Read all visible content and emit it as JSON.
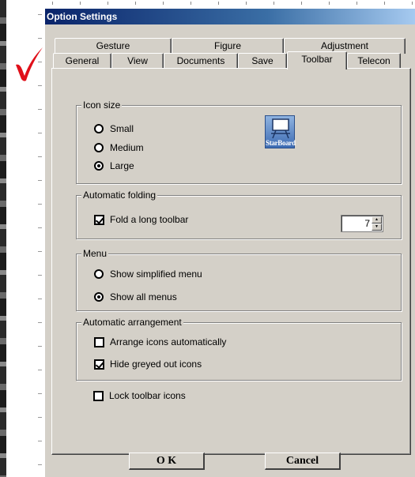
{
  "window": {
    "title": "Option Settings"
  },
  "tabs": {
    "back_row": [
      "Gesture",
      "Figure",
      "Adjustment"
    ],
    "front_row": [
      "General",
      "View",
      "Documents",
      "Save",
      "Toolbar",
      "Telecon"
    ],
    "active": "Toolbar"
  },
  "icon_size": {
    "title": "Icon size",
    "options": [
      "Small",
      "Medium",
      "Large"
    ],
    "selected": "Large",
    "preview_icon": "starboard-toolbar-icon",
    "preview_label": "StarBoard"
  },
  "automatic_folding": {
    "title": "Automatic folding",
    "checkbox_label": "Fold a long toolbar",
    "checked": true,
    "spinner_value": "7"
  },
  "menu": {
    "title": "Menu",
    "options": [
      "Show simplified menu",
      "Show all menus"
    ],
    "selected": "Show all menus"
  },
  "automatic_arrangement": {
    "title": "Automatic arrangement",
    "options": [
      {
        "label": "Arrange icons automatically",
        "checked": false
      },
      {
        "label": "Hide greyed out icons",
        "checked": true
      }
    ]
  },
  "lock": {
    "label": "Lock toolbar icons",
    "checked": false
  },
  "buttons": {
    "ok": "O K",
    "cancel": "Cancel"
  },
  "colors": {
    "face": "#d4d0c8",
    "title_start": "#0a246a",
    "annotation_mark": "#e0101a"
  }
}
